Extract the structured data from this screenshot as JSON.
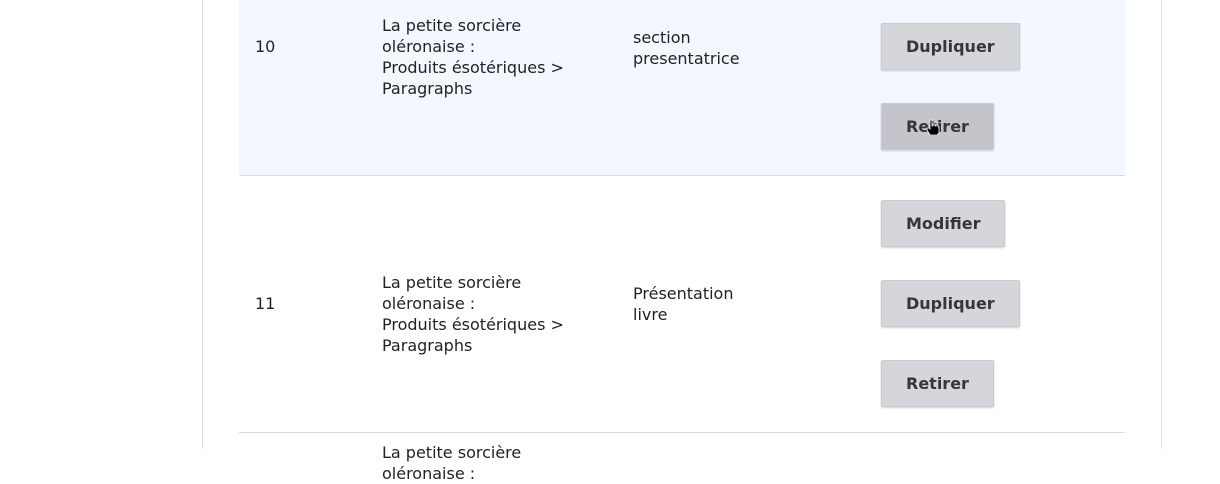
{
  "rows": [
    {
      "id": "10",
      "page": [
        "La petite sorcière oléronaise :",
        "Produits ésotériques >",
        "Paragraphs"
      ],
      "section": [
        "section",
        "presentatrice"
      ],
      "buttons": {
        "duplicate": "Dupliquer",
        "remove": "Retirer"
      }
    },
    {
      "id": "11",
      "page": [
        "La petite sorcière oléronaise :",
        "Produits ésotériques >",
        "Paragraphs"
      ],
      "section": [
        "Présentation",
        "livre"
      ],
      "buttons": {
        "edit": "Modifier",
        "duplicate": "Dupliquer",
        "remove": "Retirer"
      }
    },
    {
      "page": [
        "La petite sorcière oléronaise :"
      ]
    }
  ],
  "icons": {
    "cursor": "hand-pointer-icon"
  }
}
